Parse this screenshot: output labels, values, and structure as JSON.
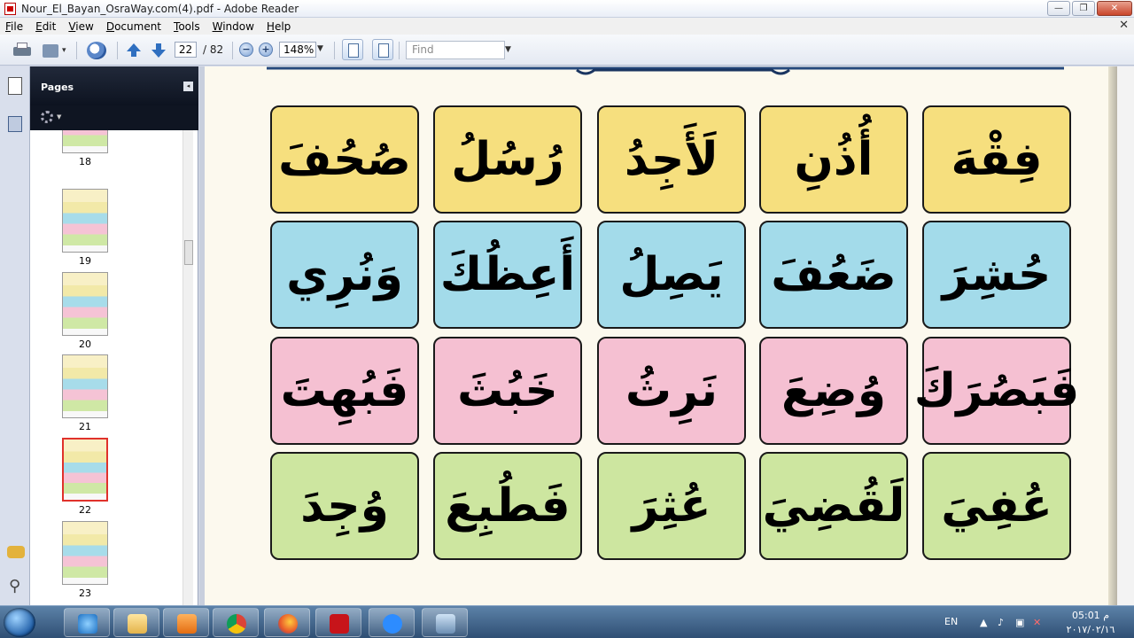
{
  "window": {
    "title": "Nour_El_Bayan_OsraWay.com(4).pdf - Adobe Reader",
    "buttons": {
      "minimize": "—",
      "maximize": "❐",
      "close": "✕"
    }
  },
  "menu": {
    "items": [
      "File",
      "Edit",
      "View",
      "Document",
      "Tools",
      "Window",
      "Help"
    ],
    "close": "✕"
  },
  "toolbar": {
    "current_page": "22",
    "total_pages": "/ 82",
    "zoom_out": "−",
    "zoom_in": "+",
    "zoom": "148%",
    "find_placeholder": "Find"
  },
  "pages_panel": {
    "title": "Pages",
    "collapse": "◂",
    "thumbnails": [
      {
        "num": "18"
      },
      {
        "num": "19"
      },
      {
        "num": "20"
      },
      {
        "num": "21"
      },
      {
        "num": "22",
        "active": true
      },
      {
        "num": "23"
      }
    ]
  },
  "colors": {
    "yellow": "#f6df7e",
    "blue": "#a3dbea",
    "pink": "#f5c0d2",
    "green": "#cde6a0",
    "vowel": "#e0242d"
  },
  "document": {
    "rows": [
      {
        "color": "yellow",
        "words": [
          "صُحُفَ",
          "رُسُلُ",
          "لَأَجِدُ",
          "أُذُنِ",
          "فِقْهَ"
        ]
      },
      {
        "color": "blue",
        "words": [
          "وَنُرِي",
          "أَعِظُكَ",
          "يَصِلُ",
          "ضَعُفَ",
          "حُشِرَ"
        ]
      },
      {
        "color": "pink",
        "words": [
          "فَبُهِتَ",
          "خَبُثَ",
          "نَرِثُ",
          "وُضِعَ",
          "فَبَصُرَكَ"
        ]
      },
      {
        "color": "green",
        "words": [
          "وُجِدَ",
          "فَطُبِعَ",
          "عُثِرَ",
          "لَقُضِيَ",
          "عُفِيَ"
        ]
      }
    ]
  },
  "taskbar": {
    "apps": [
      "ie-icon",
      "folder-icon",
      "media-icon",
      "chrome-icon",
      "firefox-icon",
      "acrobat-icon",
      "zoom-icon",
      "screen-icon"
    ],
    "lang": "EN",
    "time": "05:01 م",
    "date": "٢٠١٧/٠٢/١٦"
  }
}
